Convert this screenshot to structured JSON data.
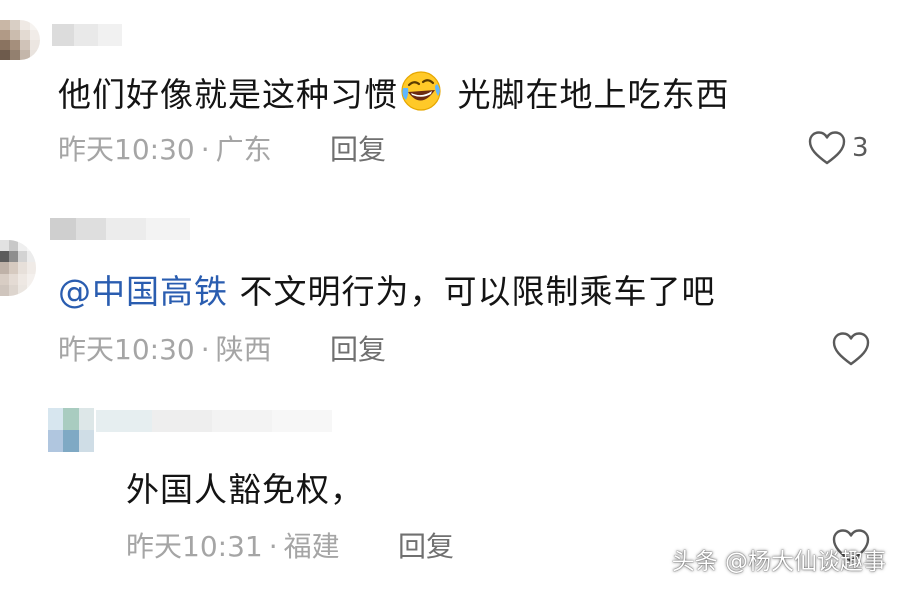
{
  "comments": [
    {
      "text_before": "他们好像就是这种习惯",
      "emoji": "rolling-on-floor-laughing",
      "text_after": " 光脚在地上吃东西",
      "time": "昨天10:30",
      "location": "广东",
      "reply_label": "回复",
      "like_count": "3"
    },
    {
      "mention": "@中国高铁",
      "text": " 不文明行为，可以限制乘车了吧",
      "time": "昨天10:30",
      "location": "陕西",
      "reply_label": "回复",
      "like_count": ""
    },
    {
      "text": "外国人豁免权，",
      "time": "昨天10:31",
      "location": "福建",
      "reply_label": "回复",
      "like_count": ""
    }
  ],
  "separator": "·",
  "watermark": "头条 @杨大仙谈趣事",
  "colors": {
    "mention": "#2a5db0",
    "meta": "#a5a5a5",
    "text": "#141414"
  }
}
